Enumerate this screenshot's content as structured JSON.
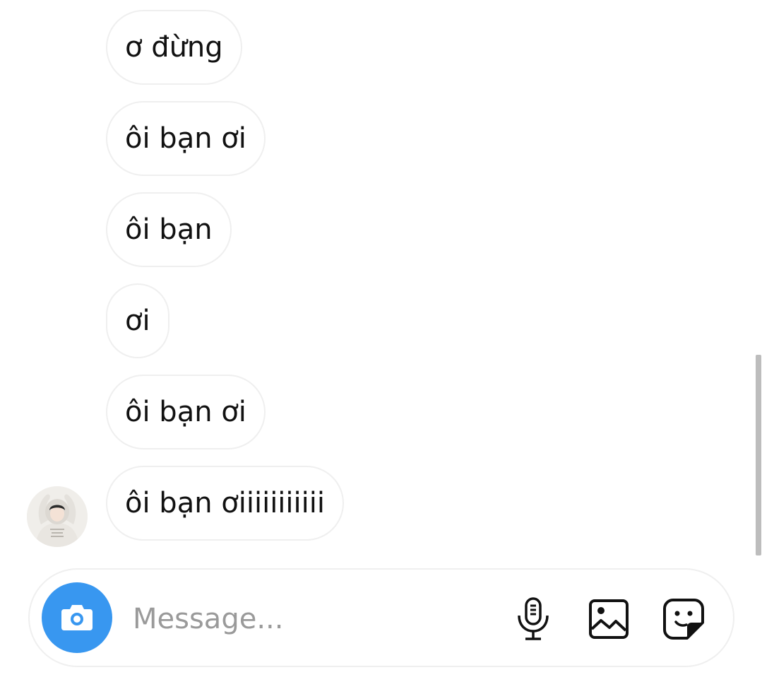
{
  "messages": [
    {
      "text": "ơ đừng"
    },
    {
      "text": "ôi bạn ơi"
    },
    {
      "text": "ôi bạn"
    },
    {
      "text": "ơi"
    },
    {
      "text": "ôi bạn ơi"
    },
    {
      "text": "ôi bạn ơiiiiiiiiiii"
    }
  ],
  "composer": {
    "placeholder": "Message...",
    "value": "",
    "camera_icon": "camera-icon",
    "mic_icon": "microphone-icon",
    "gallery_icon": "image-icon",
    "sticker_icon": "sticker-icon"
  },
  "colors": {
    "camera_button": "#3897f0",
    "bubble_border": "#efefef",
    "placeholder": "#9a9a9a",
    "text": "#111111"
  }
}
